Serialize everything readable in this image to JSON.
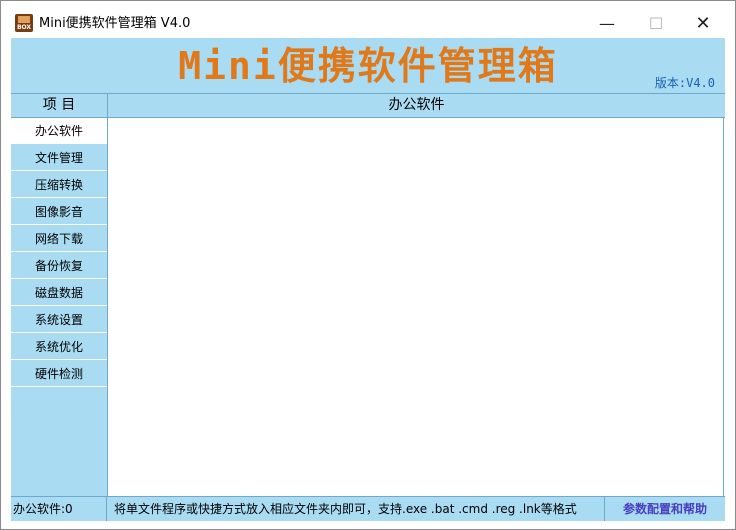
{
  "window": {
    "title": "Mini便携软件管理箱 V4.0",
    "icon_label": "BOX",
    "minimize_glyph": "—",
    "maximize_glyph": "☐",
    "close_glyph": "✕"
  },
  "banner": {
    "title": "Mini便携软件管理箱",
    "version": "版本:V4.0"
  },
  "header": {
    "left_label": "项 目",
    "current_category": "办公软件"
  },
  "sidebar": {
    "items": [
      {
        "label": "办公软件"
      },
      {
        "label": "文件管理"
      },
      {
        "label": "压缩转换"
      },
      {
        "label": "图像影音"
      },
      {
        "label": "网络下载"
      },
      {
        "label": "备份恢复"
      },
      {
        "label": "磁盘数据"
      },
      {
        "label": "系统设置"
      },
      {
        "label": "系统优化"
      },
      {
        "label": "硬件检测"
      }
    ]
  },
  "status": {
    "count": "办公软件:0",
    "hint": "将单文件程序或快捷方式放入相应文件夹内即可，支持.exe .bat .cmd .reg .lnk等格式",
    "help": "参数配置和帮助"
  },
  "colors": {
    "panel": "#a9dcf3",
    "title_orange": "#e0791a",
    "version_blue": "#1a5fb4",
    "help_purple": "#4a3fbf"
  }
}
